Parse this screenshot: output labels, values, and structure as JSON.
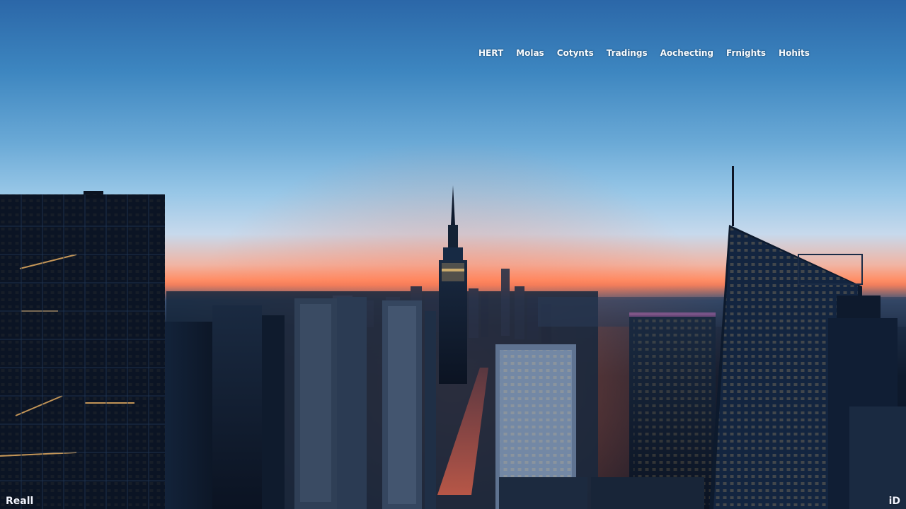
{
  "nav": {
    "items": [
      "HERT",
      "Molas",
      "Cotynts",
      "Tradings",
      "Aochecting",
      "Frnights",
      "Hohits"
    ]
  },
  "footer": {
    "left_label": "Reall",
    "right_icon_label": "iD"
  },
  "colors": {
    "sky_top": "#2b67a8",
    "sunset": "#ff8e66",
    "city_dark": "#0a1324",
    "window_glow": "#ffd27a"
  }
}
